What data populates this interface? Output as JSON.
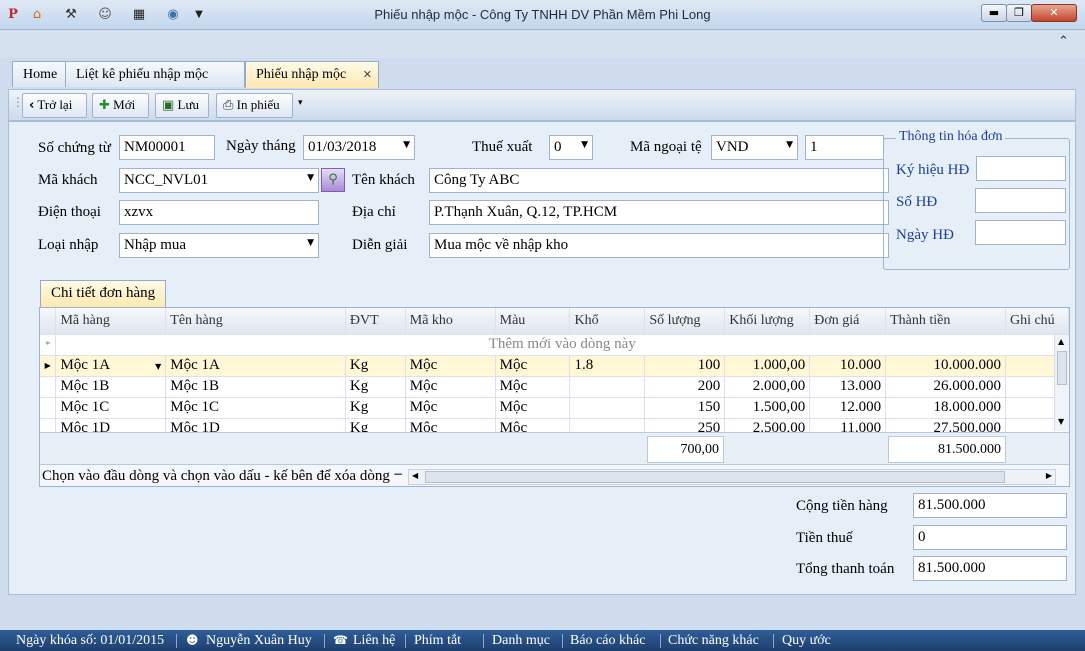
{
  "window": {
    "title": "Phiếu nhập mộc - Công Ty TNHH DV Phần Mềm Phi Long",
    "min_icon": "minimize-icon",
    "max_icon": "maximize-icon",
    "close_icon": "close-icon"
  },
  "tabs": [
    {
      "label": "Home"
    },
    {
      "label": "Liệt kê phiếu  nhập mộc"
    },
    {
      "label": "Phiếu nhập mộc",
      "active": true
    }
  ],
  "toolbar": {
    "back_label": "Trở lại",
    "new_label": "Mới",
    "save_label": "Lưu",
    "print_label": "In phiếu"
  },
  "form": {
    "so_chung_tu_label": "Số chứng từ",
    "so_chung_tu": "NM00001",
    "ngay_thang_label": "Ngày tháng",
    "ngay_thang": "01/03/2018",
    "thue_xuat_label": "Thuế xuất",
    "thue_xuat": "0",
    "ma_ngoai_te_label": "Mã ngoại tệ",
    "ma_ngoai_te": "VND",
    "ty_gia": "1",
    "ma_khach_label": "Mã khách",
    "ma_khach": "NCC_NVL01",
    "ten_khach_label": "Tên khách",
    "ten_khach": "Công Ty ABC",
    "dien_thoai_label": "Điện thoại",
    "dien_thoai": "xzvx",
    "dia_chi_label": "Địa chỉ",
    "dia_chi": "P.Thạnh Xuân, Q.12, TP.HCM",
    "loai_nhap_label": "Loại nhập",
    "loai_nhap": "Nhập mua",
    "dien_giai_label": "Diễn giải",
    "dien_giai": "Mua mộc về nhập kho"
  },
  "invoice": {
    "title": "Thông tin hóa đơn",
    "ky_hieu_label": "Ký hiệu HĐ",
    "ky_hieu": "",
    "so_hd_label": "Số HĐ",
    "so_hd": "",
    "ngay_hd_label": "Ngày HĐ",
    "ngay_hd": ""
  },
  "grid": {
    "tab_label": "Chi tiết đơn hàng",
    "columns": [
      "Mã hàng",
      "Tên hàng",
      "ĐVT",
      "Mã kho",
      "Màu",
      "Khổ",
      "Số lượng",
      "Khối lượng",
      "Đơn giá",
      "Thành tiền",
      "Ghi chú"
    ],
    "new_row_text": "Thêm mới vào dòng này",
    "new_row_marker": "*",
    "rows": [
      {
        "ma_hang": "Mộc 1A",
        "ten_hang": "Mộc 1A",
        "dvt": "Kg",
        "ma_kho": "Mộc",
        "mau": "Mộc",
        "kho": "1.8",
        "so_luong": "100",
        "khoi_luong": "1.000,00",
        "don_gia": "10.000",
        "thanh_tien": "10.000.000",
        "ghi_chu": ""
      },
      {
        "ma_hang": "Mộc 1B",
        "ten_hang": "Mộc 1B",
        "dvt": "Kg",
        "ma_kho": "Mộc",
        "mau": "Mộc",
        "kho": "",
        "so_luong": "200",
        "khoi_luong": "2.000,00",
        "don_gia": "13.000",
        "thanh_tien": "26.000.000",
        "ghi_chu": ""
      },
      {
        "ma_hang": "Mộc 1C",
        "ten_hang": "Mộc 1C",
        "dvt": "Kg",
        "ma_kho": "Mộc",
        "mau": "Mộc",
        "kho": "",
        "so_luong": "150",
        "khoi_luong": "1.500,00",
        "don_gia": "12.000",
        "thanh_tien": "18.000.000",
        "ghi_chu": ""
      },
      {
        "ma_hang": "Mộc 1D",
        "ten_hang": "Mộc 1D",
        "dvt": "Kg",
        "ma_kho": "Mộc",
        "mau": "Mộc",
        "kho": "",
        "so_luong": "250",
        "khoi_luong": "2.500,00",
        "don_gia": "11.000",
        "thanh_tien": "27.500.000",
        "ghi_chu": ""
      }
    ],
    "total_khoi_luong": "700,00",
    "total_thanh_tien": "81.500.000",
    "hint": "Chọn vào đầu dòng và chọn vào dấu - kế bên để xóa dòng",
    "hint_minus": "−"
  },
  "totals": {
    "cong_tien_hang_label": "Cộng tiền hàng",
    "cong_tien_hang": "81.500.000",
    "tien_thue_label": "Tiền thuế",
    "tien_thue": "0",
    "tong_thanh_toan_label": "Tổng thanh toán",
    "tong_thanh_toan": "81.500.000"
  },
  "statusbar": {
    "ngay_khoa_so": "Ngày khóa số: 01/01/2015",
    "user": "Nguyễn Xuân Huy",
    "lien_he": "Liên hệ",
    "phim_tat": "Phím tắt",
    "danh_muc": "Danh mục",
    "bao_cao_khac": "Báo cáo khác",
    "chuc_nang_khac": "Chức năng khác",
    "quy_uoc": "Quy ước"
  },
  "colors": {
    "statusbar": "#1d3f6e",
    "active_tab": "#fde9b0",
    "invoice_label": "#1f3f9a"
  }
}
